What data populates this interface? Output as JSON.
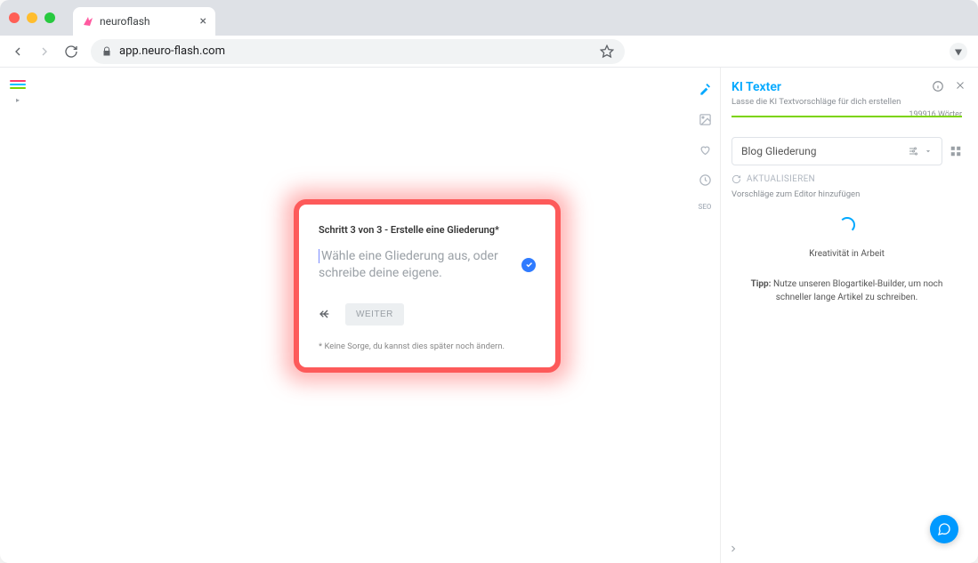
{
  "browser": {
    "tab_title": "neuroflash",
    "url": "app.neuro-flash.com"
  },
  "dialog": {
    "title": "Schritt 3 von 3 - Erstelle eine Gliederung*",
    "placeholder": "Wähle eine Gliederung aus, oder schreibe deine eigene.",
    "continue_label": "WEITER",
    "note": "* Keine Sorge, du kannst dies später noch ändern."
  },
  "panel": {
    "title": "KI Texter",
    "subtitle": "Lasse die KI Textvorschläge für dich erstellen",
    "words": "199916 Wörter",
    "select_value": "Blog Gliederung",
    "refresh_label": "AKTUALISIEREN",
    "hint": "Vorschläge zum Editor hinzufügen",
    "spinner_label": "Kreativität in Arbeit",
    "tip_label": "Tipp:",
    "tip_text": " Nutze unseren Blogartikel-Builder, um noch schneller lange Artikel zu schreiben."
  },
  "rail": {
    "seo": "SEO"
  }
}
